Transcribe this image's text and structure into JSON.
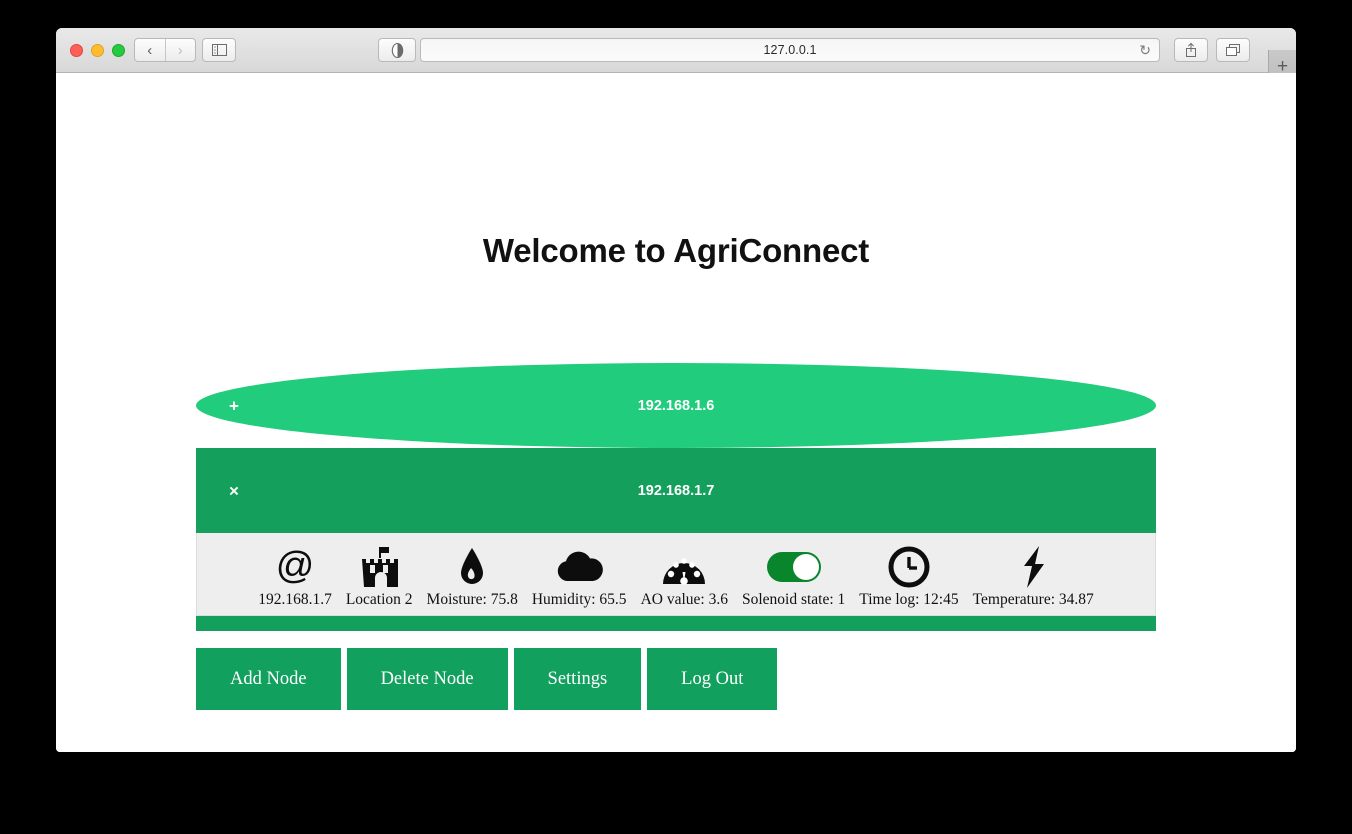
{
  "browser": {
    "url": "127.0.0.1",
    "back_label": "‹",
    "forward_label": "›",
    "sidebar_icon": "sidebar-icon",
    "reader_icon": "reader-icon",
    "share_icon": "share-icon",
    "tabs_icon": "tabs-icon",
    "newtab_label": "+",
    "reload_label": "↻"
  },
  "page": {
    "title": "Welcome to AgriConnect"
  },
  "nodes": [
    {
      "action": "+",
      "action_name": "add",
      "ip": "192.168.1.6"
    },
    {
      "action": "×",
      "action_name": "remove",
      "ip": "192.168.1.7"
    }
  ],
  "sensors": [
    {
      "icon": "at-icon",
      "label": "192.168.1.7"
    },
    {
      "icon": "fort-icon",
      "label": "Location 2"
    },
    {
      "icon": "droplet-icon",
      "label": "Moisture: 75.8"
    },
    {
      "icon": "cloud-icon",
      "label": "Humidity: 65.5"
    },
    {
      "icon": "gauge-icon",
      "label": "AO value: 3.6"
    },
    {
      "icon": "toggle-on-icon",
      "label": "Solenoid state: 1"
    },
    {
      "icon": "clock-icon",
      "label": "Time log: 12:45"
    },
    {
      "icon": "bolt-icon",
      "label": "Temperature: 34.87"
    }
  ],
  "actions": [
    {
      "label": "Add Node"
    },
    {
      "label": "Delete Node"
    },
    {
      "label": "Settings"
    },
    {
      "label": "Log Out"
    }
  ],
  "colors": {
    "node_light": "#21cc7c",
    "node_dark": "#14a05c",
    "button_green": "#11a05e",
    "toggle_green": "#09862c",
    "strip_gray": "#eeeeee"
  }
}
